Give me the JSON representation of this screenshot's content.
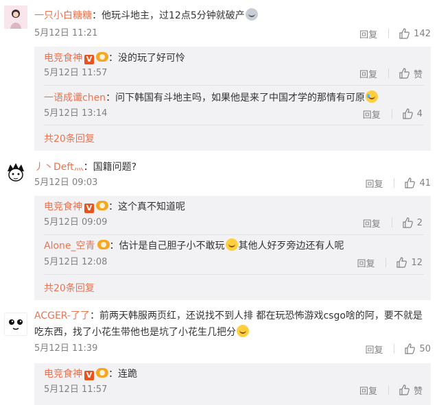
{
  "comments": [
    {
      "username": "一只小白糖糖",
      "text": "他玩斗地主，过12点5分钟就破产",
      "date": "5月12日 11:21",
      "reply_label": "回复",
      "likes": "142",
      "replies": [
        {
          "username": "电竞食神",
          "text": "没的玩了好可怜",
          "date": "5月12日 11:57",
          "reply_label": "回复",
          "likes": "赞"
        },
        {
          "username": "一语成谶chen",
          "text": "问下韩国有斗地主吗，如果他是来了中国才学的那情有可原",
          "date": "5月12日 13:14",
          "reply_label": "回复",
          "likes": "4"
        }
      ],
      "more_label": "共20条回复"
    },
    {
      "username": "丿丶Deft灬",
      "text": "国籍问题?",
      "date": "5月12日 09:03",
      "reply_label": "回复",
      "likes": "41",
      "replies": [
        {
          "username": "电竞食神",
          "text": "这个真不知道呢",
          "date": "5月12日 09:09",
          "reply_label": "回复",
          "likes": "2"
        },
        {
          "username": "Alone_空青",
          "text_a": "估计是自己胆子小不敢玩",
          "text_b": "其他人好歹旁边还有人呢",
          "date": "5月12日 12:08",
          "reply_label": "回复",
          "likes": "12"
        }
      ],
      "more_label": "共20条回复"
    },
    {
      "username": "ACGER-了了",
      "text_line1": "前两天韩服两页红，还说找不到人排 都在玩恐怖游戏csgo啥的阿，要不就是",
      "text_line2": "吃东西，找了小花生带他也是坑了小花生几把分",
      "date": "5月12日 11:39",
      "reply_label": "回复",
      "likes": "50",
      "replies": [
        {
          "username": "电竞食神",
          "text": "连跪",
          "date": "5月12日 11:57",
          "reply_label": "回复",
          "likes": "赞"
        }
      ]
    }
  ],
  "colors": {
    "username": "#eb7350",
    "thread_bg": "#f2f2f5",
    "meta": "#808080"
  },
  "icons": {
    "like": "thumb-up-icon",
    "verified": "verified-v-icon",
    "fan": "fan-badge-icon"
  }
}
